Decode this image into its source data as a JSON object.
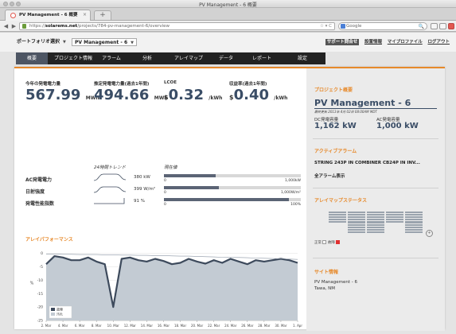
{
  "window": {
    "title": "PV Management - 6 概要"
  },
  "browser": {
    "tab_title": "PV Management - 6 概要",
    "tab_close": "×",
    "new_tab": "+",
    "url_prefix": "https://",
    "url_host": "solarems.net",
    "url_path": "/projects/784-pv-management-6/overview",
    "url_right": "☆ ▾ C",
    "search_placeholder": "Google",
    "search_icon": "🔍"
  },
  "topbar": {
    "portfolio_label": "ポートフォリオ選択",
    "project_select": "PV Management - 6",
    "links": [
      "サポート問合せ",
      "設置情報",
      "マイプロファイル",
      "ログアウト"
    ]
  },
  "nav": {
    "items": [
      "概要",
      "プロジェクト情報",
      "アラーム",
      "分析",
      "アレイマップ",
      "データ",
      "レポート",
      "設定"
    ]
  },
  "kpis": [
    {
      "label": "今年の発電電力量",
      "prefix": "",
      "value": "567.99",
      "unit": "MWh"
    },
    {
      "label": "推定発電電力量(過去1年間)",
      "prefix": "",
      "value": "494.66",
      "unit": "MWh"
    },
    {
      "label": "LCOE",
      "prefix": "$",
      "value": "0.32",
      "unit": "/kWh"
    },
    {
      "label": "収益率(過去1年間)",
      "prefix": "$",
      "value": "0.40",
      "unit": "/kWh"
    }
  ],
  "metrics": {
    "trend_header": "24時間トレンド",
    "current_header": "現在値",
    "rows": [
      {
        "label": "AC発電電力",
        "value": "380 kW",
        "min": "0",
        "max": "1,000kW",
        "fraction": 0.38
      },
      {
        "label": "日射強度",
        "value": "399 W/m²",
        "min": "0",
        "max": "1,000W/m²",
        "fraction": 0.4
      },
      {
        "label": "発電性能指数",
        "value": "91 %",
        "min": "0",
        "max": "100%",
        "fraction": 0.91
      }
    ]
  },
  "chart_data": {
    "type": "area",
    "title": "アレイパフォーマンス",
    "xlabel": "",
    "ylabel": "%",
    "ylim": [
      -25,
      2
    ],
    "yticks": [
      0,
      -5,
      -10,
      -15,
      -20,
      -25
    ],
    "x_ticks": [
      "2. Mar",
      "4. Mar",
      "6. Mar",
      "8. Mar",
      "10. Mar",
      "12. Mar",
      "14. Mar",
      "16. Mar",
      "18. Mar",
      "20. Mar",
      "22. Mar",
      "24. Mar",
      "26. Mar",
      "28. Mar",
      "30. Mar",
      "1. Apr"
    ],
    "x": [
      "2. Mar",
      "3. Mar",
      "4. Mar",
      "5. Mar",
      "6. Mar",
      "7. Mar",
      "8. Mar",
      "9. Mar",
      "10. Mar",
      "11. Mar",
      "12. Mar",
      "13. Mar",
      "14. Mar",
      "15. Mar",
      "16. Mar",
      "17. Mar",
      "18. Mar",
      "19. Mar",
      "20. Mar",
      "21. Mar",
      "22. Mar",
      "23. Mar",
      "24. Mar",
      "25. Mar",
      "26. Mar",
      "27. Mar",
      "28. Mar",
      "29. Mar",
      "30. Mar",
      "31. Mar",
      "1. Apr"
    ],
    "series": [
      {
        "name": "故障",
        "color": "#3d4a5c",
        "values": [
          -4.0,
          -1.0,
          -1.5,
          -2.5,
          -2.5,
          -1.5,
          -3.0,
          -4.0,
          -20.0,
          -2.0,
          -1.5,
          -2.5,
          -3.0,
          -2.0,
          -2.8,
          -4.0,
          -3.5,
          -2.0,
          -3.0,
          -3.8,
          -2.5,
          -3.5,
          -2.0,
          -3.0,
          -4.0,
          -2.5,
          -3.0,
          -2.5,
          -2.0,
          -2.5,
          -3.5
        ]
      },
      {
        "name": "汚れ",
        "color": "#c3cbd3",
        "values": [
          -0.2,
          -0.2,
          -0.3,
          -0.3,
          -0.4,
          -0.4,
          -0.4,
          -0.5,
          -0.5,
          -0.6,
          -0.6,
          -0.7,
          -0.7,
          -0.8,
          -0.8,
          -0.9,
          -1.0,
          -1.0,
          -1.1,
          -1.2,
          -1.3,
          -1.4,
          -1.5,
          -1.5,
          -1.6,
          -1.7,
          -1.8,
          -1.9,
          -2.0,
          -2.1,
          -2.2
        ]
      }
    ],
    "grid": true,
    "legend_position": "bottom-left"
  },
  "right_panel": {
    "project_section_title": "プロジェクト概要",
    "project_name": "PV Management - 6",
    "last_updated": "最終更新 2013年 4月 02日 08:00AM MDT",
    "dc_label": "DC発電容量",
    "dc_value": "1,162 kW",
    "ac_label": "AC発電容量",
    "ac_value": "1,000 kW",
    "alarm_section_title": "アクティブアラーム",
    "alarm_text": "STRING 243P IN COMBINER CB24P IN INV...",
    "alarm_link": "全アラーム表示",
    "arraymap_section_title": "アレイマップステータス",
    "legend_normal": "正常",
    "legend_fault": "故障",
    "site_section_title": "サイト情報",
    "site_name": "PV Management - 6",
    "site_location": "Tawa, NM"
  },
  "colors": {
    "accent": "#e7892a",
    "nav_bg": "#222222",
    "kpi": "#3a4d66",
    "fault": "#e03030",
    "normal": "#ffffff"
  }
}
